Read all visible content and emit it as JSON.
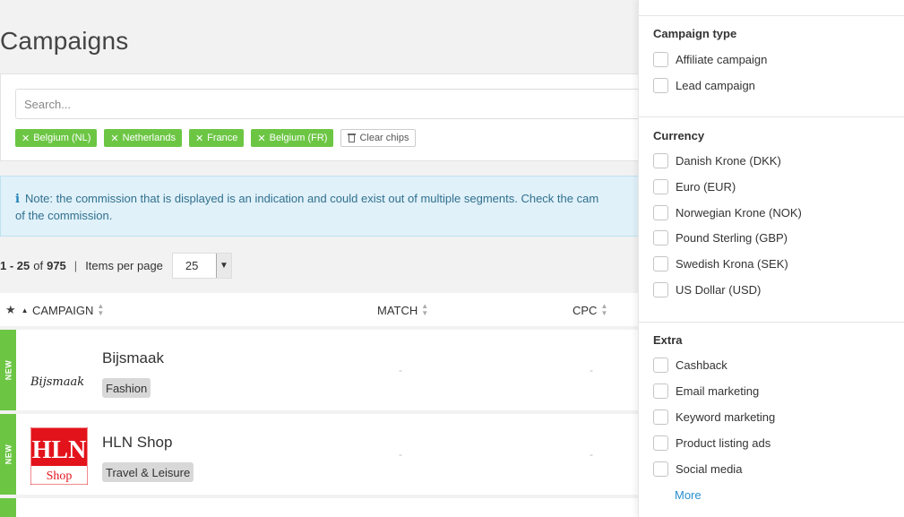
{
  "page": {
    "title": "Campaigns"
  },
  "search": {
    "placeholder": "Search..."
  },
  "chips": [
    "Belgium (NL)",
    "Netherlands",
    "France",
    "Belgium (FR)"
  ],
  "clear_chips_label": "Clear chips",
  "note": {
    "line1": "Note: the commission that is displayed is an indication and could exist out of multiple segments. Check the cam",
    "line2": "of the commission."
  },
  "pagination": {
    "range": "1 - 25",
    "of": "of",
    "total": "975",
    "separator": "|",
    "items_label": "Items per page",
    "per_page": "25"
  },
  "table": {
    "columns": {
      "campaign": "CAMPAIGN",
      "match": "MATCH",
      "cpc": "CPC"
    },
    "rows": [
      {
        "badge": "NEW",
        "name": "Bijsmaak",
        "tag": "Fashion",
        "match": "-",
        "cpc": "-",
        "logo_text": "Bijsmaak"
      },
      {
        "badge": "NEW",
        "name": "HLN Shop",
        "tag": "Travel & Leisure",
        "match": "-",
        "cpc": "-",
        "logo_text": "HLN",
        "logo_sub": "Shop"
      }
    ]
  },
  "side": {
    "campaign_type": {
      "title": "Campaign type",
      "options": [
        "Affiliate campaign",
        "Lead campaign"
      ]
    },
    "currency": {
      "title": "Currency",
      "options": [
        "Danish Krone (DKK)",
        "Euro (EUR)",
        "Norwegian Krone (NOK)",
        "Pound Sterling (GBP)",
        "Swedish Krona (SEK)",
        "US Dollar (USD)"
      ]
    },
    "extra": {
      "title": "Extra",
      "options": [
        "Cashback",
        "Email marketing",
        "Keyword marketing",
        "Product listing ads",
        "Social media"
      ],
      "more": "More"
    }
  },
  "colors": {
    "chip": "#6cc644",
    "new_bar": "#6cc644",
    "note_bg": "#e0f1f9",
    "link": "#2a8fd0",
    "hln_red": "#e3131b"
  }
}
